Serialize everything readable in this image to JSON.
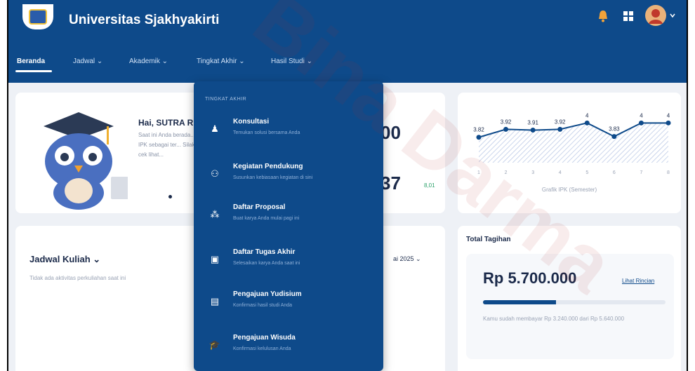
{
  "app": {
    "title": "Universitas Sjakhyakirti"
  },
  "header_icons": [
    "bell-icon",
    "grid-icon",
    "avatar"
  ],
  "nav": {
    "items": [
      {
        "label": "Beranda",
        "active": true
      },
      {
        "label": "Jadwal ⌄"
      },
      {
        "label": "Akademik ⌄"
      },
      {
        "label": "Tingkat Akhir ⌄"
      },
      {
        "label": "Hasil Studi ⌄"
      }
    ]
  },
  "greeting": {
    "name": "Hai, SUTRA R",
    "text": "Saat ini Anda berada... IPK sebagai ter... Silakan cek lihat..."
  },
  "stats": {
    "value_a": "00",
    "value_b": "37",
    "badge": "8,01"
  },
  "dropdown": {
    "heading": "TINGKAT AKHIR",
    "items": [
      {
        "title": "Konsultasi",
        "sub": "Temukan solusi bersama Anda",
        "icon": "person-icon"
      },
      {
        "title": "Kegiatan Pendukung",
        "sub": "Susunkan kebiasaan kegiatan di sini",
        "icon": "people-icon"
      },
      {
        "title": "Daftar Proposal",
        "sub": "Buat karya Anda mulai pagi ini",
        "icon": "proposal-icon"
      },
      {
        "title": "Daftar Tugas Akhir",
        "sub": "Selesaikan karya Anda saat ini",
        "icon": "thesis-icon"
      },
      {
        "title": "Pengajuan Yudisium",
        "sub": "Konfirmasi hasil studi Anda",
        "icon": "document-icon"
      },
      {
        "title": "Pengajuan Wisuda",
        "sub": "Konfirmasi kelulusan Anda",
        "icon": "graduation-cap-icon"
      }
    ]
  },
  "ipk_chart": {
    "caption": "Grafik IPK (Semester)",
    "chart_data": {
      "type": "area",
      "x": [
        1,
        2,
        3,
        4,
        5,
        6,
        7,
        8
      ],
      "values": [
        3.82,
        3.92,
        3.91,
        3.92,
        4,
        3.83,
        4,
        4
      ],
      "labels": [
        "3.82",
        "3.92",
        "3.91",
        "3.92",
        "4",
        "3.83",
        "4",
        "4"
      ],
      "xlabel": "Grafik IPK (Semester)"
    }
  },
  "jadwal": {
    "title": "Jadwal Kuliah ⌄",
    "empty": "Tidak ada aktivitas perkuliahan saat ini",
    "period": "ai 2025 ⌄"
  },
  "tagihan": {
    "title": "Total Tagihan",
    "amount": "Rp 5.700.000",
    "link": "Lihat Rincian",
    "progress": 0.4,
    "note": "Kamu sudah membayar Rp 3.240.000 dari Rp 5.640.000"
  },
  "watermark": "Bina Darma"
}
